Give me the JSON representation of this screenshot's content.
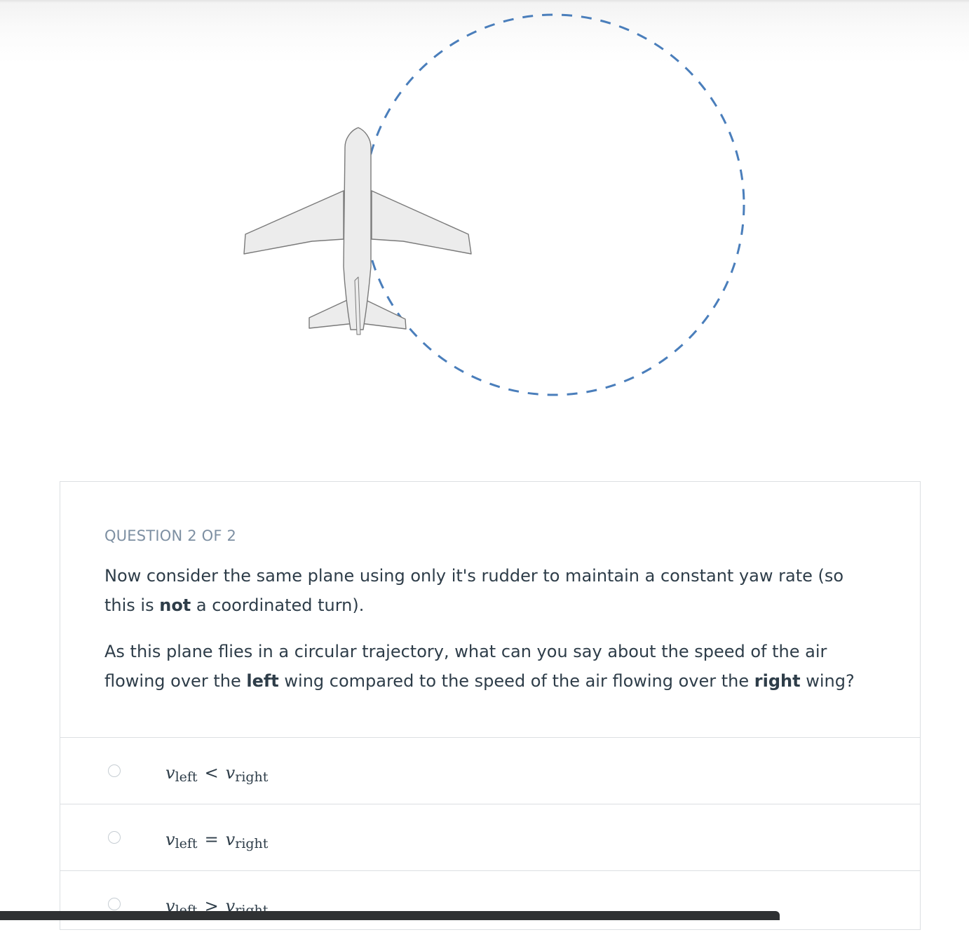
{
  "quiz": {
    "counter": "QUESTION 2 OF 2",
    "paragraph1": {
      "before": "Now consider the same plane using only it's rudder to maintain a constant yaw rate (so this is ",
      "bold": "not",
      "after": " a coordinated turn)."
    },
    "paragraph2": {
      "part1": "As this plane flies in a circular trajectory, what can you say about the speed of the air flowing over the ",
      "bold1": "left",
      "part2": " wing compared to the speed of the air flowing over the ",
      "bold2": "right",
      "part3": " wing?"
    },
    "options": [
      {
        "var": "v",
        "sub_left": "left",
        "operator": "<",
        "sub_right": "right"
      },
      {
        "var": "v",
        "sub_left": "left",
        "operator": "=",
        "sub_right": "right"
      },
      {
        "var": "v",
        "sub_left": "left",
        "operator": ">",
        "sub_right": "right"
      }
    ]
  },
  "colors": {
    "trajectory": "#4a7ebb",
    "plane_fill": "#ececec",
    "plane_stroke": "#7a7a7a",
    "question_text": "#2e3d49",
    "counter_text": "#7d8fa2",
    "border": "#dcdfe2"
  },
  "icons": {
    "diagram": "airplane-icon",
    "trajectory": "dashed-circle",
    "option_marker": "radio-button-icon"
  }
}
